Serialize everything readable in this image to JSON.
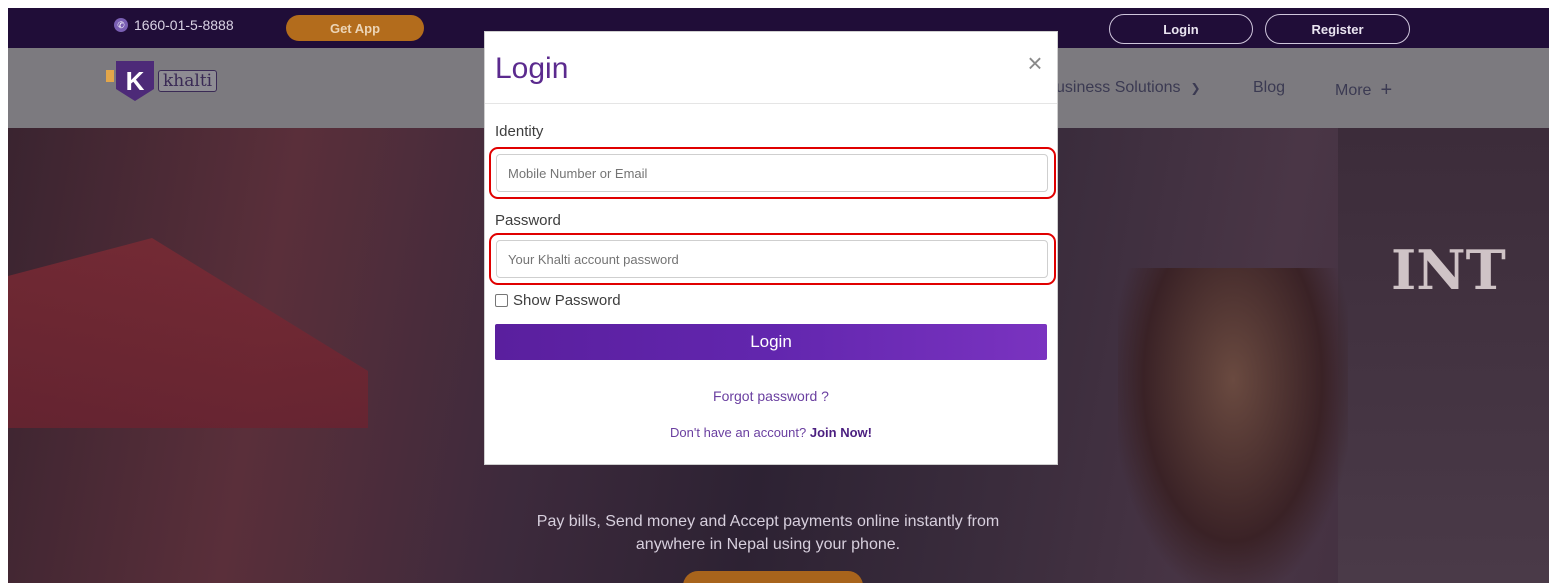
{
  "topbar": {
    "phone": "1660-01-5-8888",
    "get_app": "Get App",
    "login": "Login",
    "register": "Register"
  },
  "navbar": {
    "logo_text": "khalti",
    "logo_letter": "K",
    "items": [
      {
        "label": "usiness Solutions"
      },
      {
        "label": "Blog"
      },
      {
        "label": "More"
      }
    ]
  },
  "hero": {
    "sign": "INT",
    "subtitle_line1": "Pay bills, Send money and Accept payments online instantly from",
    "subtitle_line2": "anywhere in Nepal using your phone."
  },
  "modal": {
    "title": "Login",
    "identity_label": "Identity",
    "identity_placeholder": "Mobile Number or Email",
    "password_label": "Password",
    "password_placeholder": "Your Khalti account password",
    "show_password_label": "Show Password",
    "submit_label": "Login",
    "forgot_label": "Forgot password ?",
    "no_account_text": "Don't have an account?",
    "join_label": "Join Now!"
  },
  "colors": {
    "brand_purple": "#5b2a8e",
    "highlight_red": "#e00000",
    "get_app_orange": "#b36c1c",
    "topbar_bg": "#200d38"
  }
}
